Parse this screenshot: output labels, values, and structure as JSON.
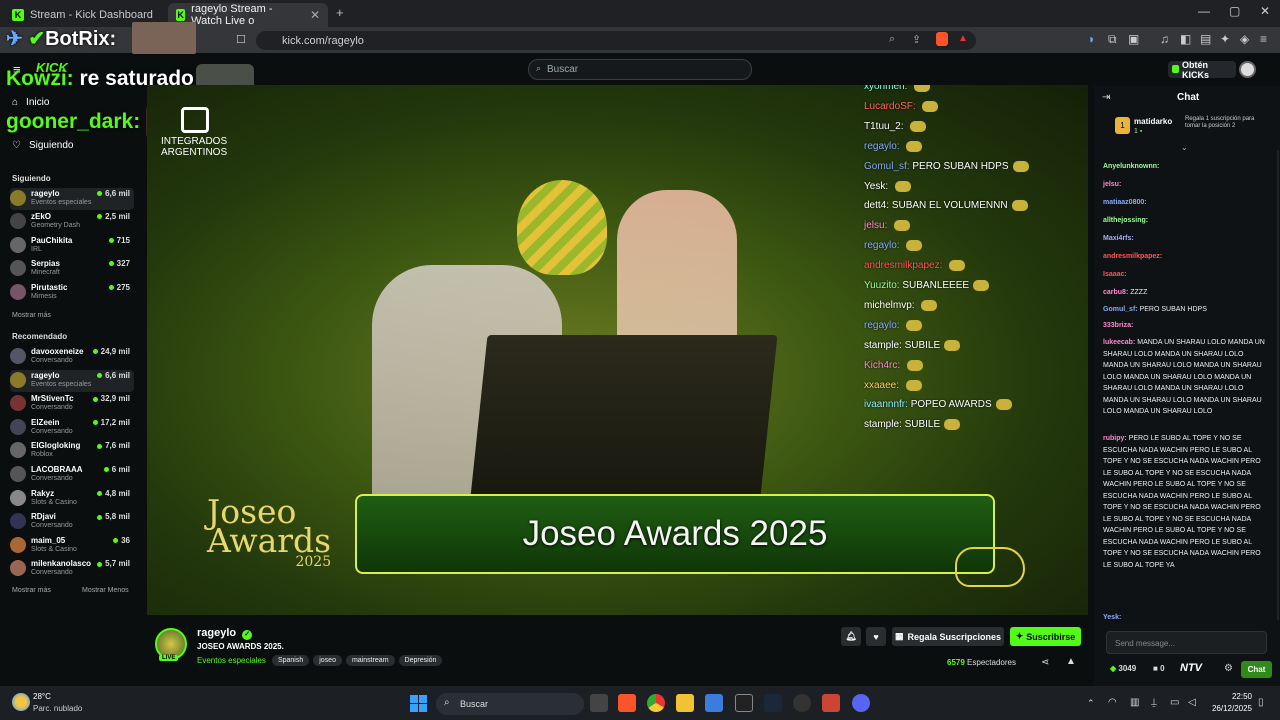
{
  "browser": {
    "tabs": [
      {
        "label": "Stream - Kick Dashboard"
      },
      {
        "label": "rageylo Stream - Watch Live o"
      }
    ],
    "url": "kick.com/rageylo"
  },
  "overlay": {
    "line1_prefix": "Kowzi:",
    "line1_text": "re saturado",
    "line2": "gooner_dark:",
    "botrix": "BotRix:",
    "kick_logo": "KICK",
    "integrados": "INTEGRADOS",
    "argentinos": "ARGENTINOS"
  },
  "nav": {
    "search_placeholder": "Buscar",
    "get_kicks": "Obtén KICKs",
    "inicio": "Inicio",
    "siguiendo": "Siguiendo"
  },
  "sidebar": {
    "following_header": "Siguiendo",
    "following": [
      {
        "name": "rageylo",
        "category": "Eventos especiales",
        "viewers": "6,6 mil",
        "color": "#8a7a2a"
      },
      {
        "name": "zEkO",
        "category": "Geometry Dash",
        "viewers": "2,5 mil",
        "color": "#444"
      },
      {
        "name": "PauChikita",
        "category": "IRL",
        "viewers": "715",
        "color": "#666"
      },
      {
        "name": "Serpias",
        "category": "Minecraft",
        "viewers": "327",
        "color": "#555"
      },
      {
        "name": "Pirutastic",
        "category": "Mimesis",
        "viewers": "275",
        "color": "#775566"
      }
    ],
    "show_more": "Mostrar más",
    "recommended_header": "Recomendado",
    "recommended": [
      {
        "name": "davooxeneize",
        "category": "Conversando",
        "viewers": "24,9 mil",
        "color": "#556"
      },
      {
        "name": "rageylo",
        "category": "Eventos especiales",
        "viewers": "6,6 mil",
        "color": "#8a7a2a"
      },
      {
        "name": "MrStivenTc",
        "category": "Conversando",
        "viewers": "32,9 mil",
        "color": "#733"
      },
      {
        "name": "ElZeein",
        "category": "Conversando",
        "viewers": "17,2 mil",
        "color": "#445"
      },
      {
        "name": "ElGlogloking",
        "category": "Roblox",
        "viewers": "7,6 mil",
        "color": "#666"
      },
      {
        "name": "LACOBRAAA",
        "category": "Conversando",
        "viewers": "6 mil",
        "color": "#555"
      },
      {
        "name": "Rakyz",
        "category": "Slots & Casino",
        "viewers": "4,8 mil",
        "color": "#888"
      },
      {
        "name": "RDjavi",
        "category": "Conversando",
        "viewers": "5,8 mil",
        "color": "#335"
      },
      {
        "name": "maim_05",
        "category": "Slots & Casino",
        "viewers": "36",
        "color": "#a63"
      },
      {
        "name": "milenkanolasco",
        "category": "Conversando",
        "viewers": "5,7 mil",
        "color": "#965"
      }
    ],
    "show_more2": "Mostrar más",
    "show_less": "Mostrar Menos"
  },
  "video": {
    "banner": "Joseo Awards 2025",
    "logo_line1": "Joseo",
    "logo_line2": "Awards",
    "logo_year": "2025",
    "chat": [
      {
        "user": "xyonmen:",
        "text": "",
        "color": "#8fd"
      },
      {
        "user": "LucardoSF:",
        "text": "",
        "color": "#f66"
      },
      {
        "user": "T1tuu_2:",
        "text": "",
        "color": "#fff"
      },
      {
        "user": "regaylo:",
        "text": "",
        "color": "#8af"
      },
      {
        "user": "Gomul_sf:",
        "text": "PERO SUBAN HDPS",
        "color": "#8ae"
      },
      {
        "user": "Yesk:",
        "text": "",
        "color": "#fff"
      },
      {
        "user": "dett4:",
        "text": "SUBAN EL VOLUMENNN",
        "color": "#fff"
      },
      {
        "user": "jelsu:",
        "text": "",
        "color": "#f8c"
      },
      {
        "user": "regaylo:",
        "text": "",
        "color": "#8af"
      },
      {
        "user": "andresmilkpapez:",
        "text": "",
        "color": "#f55"
      },
      {
        "user": "Yuuzito:",
        "text": "SUBANLEEEE",
        "color": "#9f9"
      },
      {
        "user": "michelmvp:",
        "text": "",
        "color": "#fff"
      },
      {
        "user": "regaylo:",
        "text": "",
        "color": "#8af"
      },
      {
        "user": "stample:",
        "text": "SUBILE",
        "color": "#fff"
      },
      {
        "user": "Kich4rc:",
        "text": "",
        "color": "#f8c"
      },
      {
        "user": "xxaaee:",
        "text": "",
        "color": "#fc6"
      },
      {
        "user": "ivaannnfr:",
        "text": "POPEO AWARDS",
        "color": "#8ef"
      },
      {
        "user": "stample:",
        "text": "SUBILE",
        "color": "#fff"
      }
    ]
  },
  "stream_info": {
    "channel": "rageylo",
    "title": "JOSEO AWARDS 2025.",
    "category": "Eventos especiales",
    "tags": [
      "Spanish",
      "joseo",
      "mainstream",
      "Depresión"
    ],
    "live_badge": "LIVE",
    "gift_label": "Regala Suscripciones",
    "subscribe_label": "Suscribirse",
    "viewers": "6579",
    "viewers_label": "Espectadores"
  },
  "chat": {
    "title": "Chat",
    "pinned_user": "matidarko",
    "pinned_count": "1",
    "pinned_text": "Regala 1 suscripción para tomar la posición 2",
    "messages": [
      {
        "user": "Anyelunknownn:",
        "text": "",
        "color": "#9f9"
      },
      {
        "user": "jelsu:",
        "text": "",
        "color": "#f8c"
      },
      {
        "user": "matiaaz0800:",
        "text": "",
        "color": "#8af"
      },
      {
        "user": "allthejossing:",
        "text": "",
        "color": "#9f9"
      },
      {
        "user": "Maxi4rfs:",
        "text": "",
        "color": "#aaf"
      },
      {
        "user": "andresmilkpapez:",
        "text": "",
        "color": "#f55"
      },
      {
        "user": "Isaaac:",
        "text": "",
        "color": "#f55"
      },
      {
        "user": "carbu8:",
        "text": "ZZZZ",
        "color": "#f8c"
      },
      {
        "user": "Gomul_sf:",
        "text": "PERO SUBAN HDPS",
        "color": "#8ae"
      },
      {
        "user": "333briza:",
        "text": "",
        "color": "#f8c"
      },
      {
        "user": "lukeecab:",
        "text": "MANDA UN SHARAU LOLO MANDA UN SHARAU LOLO MANDA UN SHARAU LOLO MANDA UN SHARAU LOLO MANDA UN SHARAU LOLO MANDA UN SHARAU LOLO MANDA UN SHARAU LOLO MANDA UN SHARAU LOLO MANDA UN SHARAU LOLO MANDA UN SHARAU LOLO MANDA UN SHARAU LOLO",
        "color": "#f8c"
      },
      {
        "user": "rubipy:",
        "text": "PERO LE SUBO AL TOPE Y NO SE ESCUCHA NADA WACHIN PERO LE SUBO AL TOPE Y NO SE ESCUCHA NADA WACHIN PERO LE SUBO AL TOPE Y NO SE ESCUCHA NADA WACHIN PERO LE SUBO AL TOPE Y NO SE ESCUCHA NADA WACHIN PERO LE SUBO AL TOPE Y NO SE ESCUCHA NADA WACHIN PERO LE SUBO AL TOPE Y NO SE ESCUCHA NADA WACHIN PERO LE SUBO AL TOPE Y NO SE ESCUCHA NADA WACHIN PERO LE SUBO AL TOPE Y NO SE ESCUCHA NADA WACHIN PERO LE SUBO AL TOPE YA",
        "color": "#f8c"
      },
      {
        "user": "Yesk:",
        "text": "",
        "color": "#8af"
      }
    ],
    "input_placeholder": "Send message...",
    "points": "3049",
    "kicks": "0",
    "ntv": "NTV",
    "chat_button": "Chat"
  },
  "taskbar": {
    "temp": "28°C",
    "weather": "Parc. nublado",
    "search": "Buscar",
    "time": "22:50",
    "date": "26/12/2025"
  },
  "colors": {
    "kick_green": "#53fc18",
    "background": "#0b0e0f"
  }
}
